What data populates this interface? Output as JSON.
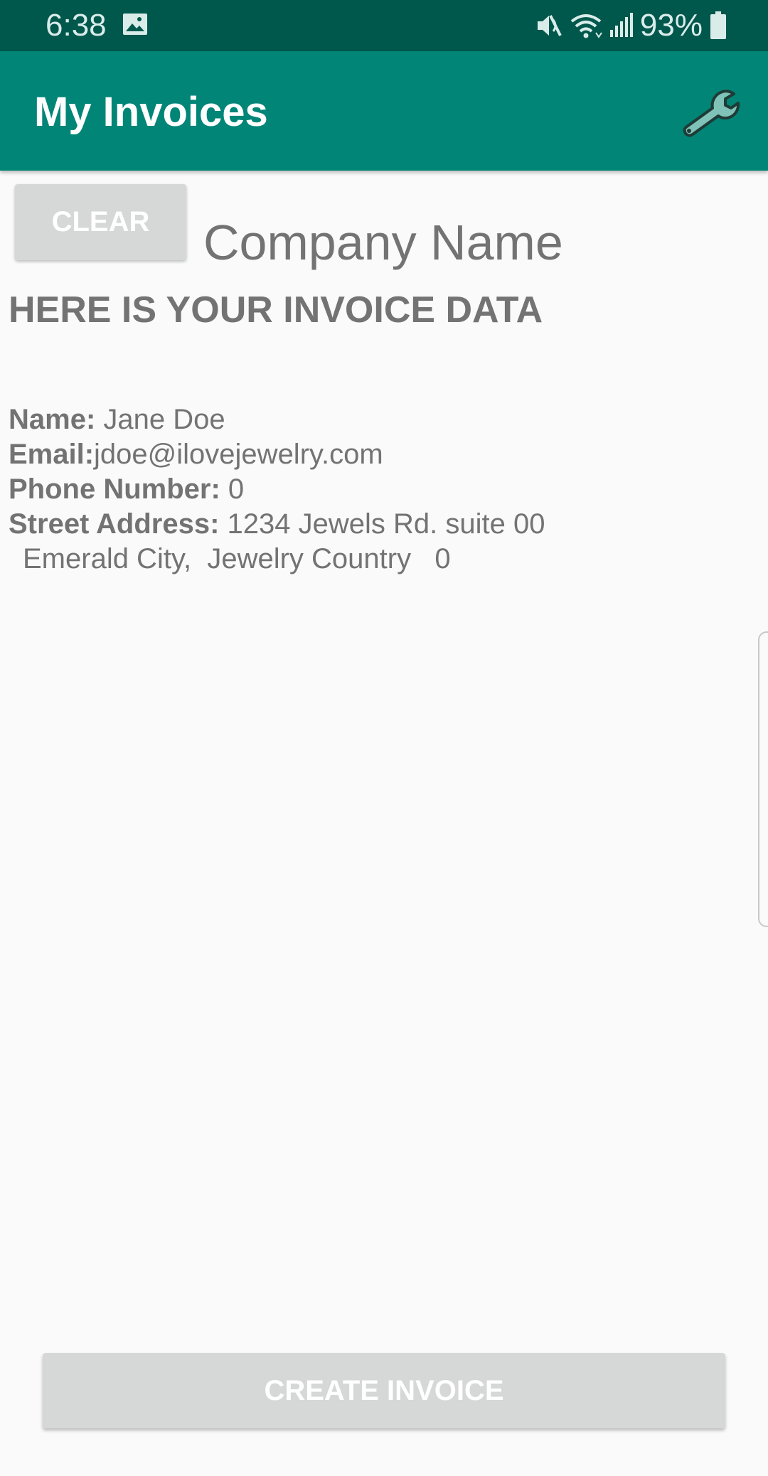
{
  "status_bar": {
    "time": "6:38",
    "battery_percent": "93%",
    "icons": [
      "gallery-icon",
      "mute-icon",
      "wifi-icon",
      "signal-icon",
      "battery-icon"
    ]
  },
  "app_bar": {
    "title": "My Invoices",
    "action_icon": "wrench-icon"
  },
  "main": {
    "clear_label": "CLEAR",
    "company_name": "Company Name",
    "heading": "HERE IS YOUR INVOICE DATA",
    "name_label": "Name:",
    "name_value": " Jane Doe",
    "email_label": "Email:",
    "email_value": "jdoe@ilovejewelry.com",
    "phone_label": "Phone Number:",
    "phone_value": " 0",
    "street_label": "Street Address:",
    "street_value": " 1234 Jewels Rd. suite 00",
    "city_line": "Emerald City,  Jewelry Country   0",
    "create_label": "CREATE INVOICE"
  },
  "colors": {
    "status_bar": "#00574b",
    "app_bar": "#008577",
    "button_disabled": "#d6d7d7",
    "text": "#737373",
    "background": "#fafafa"
  }
}
